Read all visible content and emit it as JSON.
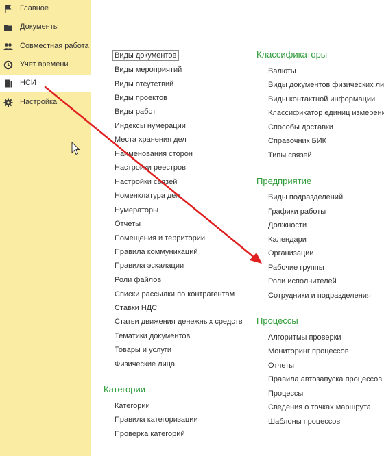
{
  "sidebar": {
    "items": [
      {
        "label": "Главное",
        "icon": "flag-icon"
      },
      {
        "label": "Документы",
        "icon": "folder-icon"
      },
      {
        "label": "Совместная работа",
        "icon": "users-icon"
      },
      {
        "label": "Учет времени",
        "icon": "clock-icon"
      },
      {
        "label": "НСИ",
        "icon": "book-icon",
        "active": true
      },
      {
        "label": "Настройка",
        "icon": "gear-icon"
      }
    ]
  },
  "left_column": {
    "links": [
      "Виды документов",
      "Виды мероприятий",
      "Виды отсутствий",
      "Виды проектов",
      "Виды работ",
      "Индексы нумерации",
      "Места хранения дел",
      "Наименования сторон",
      "Настройки реестров",
      "Настройки связей",
      "Номенклатура дел",
      "Нумераторы",
      "Отчеты",
      "Помещения и территории",
      "Правила коммуникаций",
      "Правила эскалации",
      "Роли файлов",
      "Списки рассылки по контрагентам",
      "Ставки НДС",
      "Статьи движения денежных средств",
      "Тематики документов",
      "Товары и услуги",
      "Физические лица"
    ],
    "categories_title": "Категории",
    "categories_links": [
      "Категории",
      "Правила категоризации",
      "Проверка категорий"
    ]
  },
  "right_column": {
    "classifiers_title": "Классификаторы",
    "classifiers_links": [
      "Валюты",
      "Виды документов физических лиц",
      "Виды контактной информации",
      "Классификатор единиц измерения",
      "Способы доставки",
      "Справочник БИК",
      "Типы связей"
    ],
    "enterprise_title": "Предприятие",
    "enterprise_links": [
      "Виды подразделений",
      "Графики работы",
      "Должности",
      "Календари",
      "Организации",
      "Рабочие группы",
      "Роли исполнителей",
      "Сотрудники и подразделения"
    ],
    "processes_title": "Процессы",
    "processes_links": [
      "Алгоритмы проверки",
      "Мониторинг процессов",
      "Отчеты",
      "Правила автозапуска процессов",
      "Процессы",
      "Сведения о точках маршрута",
      "Шаблоны процессов"
    ]
  },
  "colors": {
    "sidebar_bg": "#fbeca4",
    "section_title": "#2f9c3a",
    "arrow": "#e02020"
  }
}
